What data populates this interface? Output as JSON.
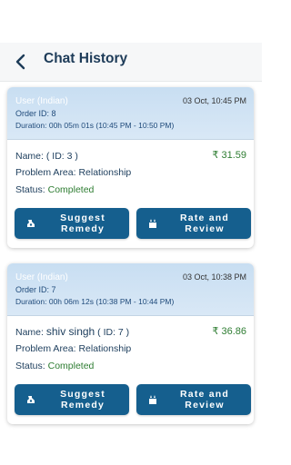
{
  "header": {
    "title": "Chat History"
  },
  "orders": [
    {
      "user": "User (Indian)",
      "date": "03 Oct, 10:45 PM",
      "order_id": "Order ID: 8",
      "duration": "Duration: 00h 05m 01s (10:45 PM - 10:50 PM)",
      "name_label": "Name:",
      "name": "",
      "id_text": "( ID: 3 )",
      "price": "₹ 31.59",
      "problem": "Problem Area: Relationship",
      "status_label": "Status:",
      "status_value": "Completed",
      "suggest_line1": "Suggest",
      "suggest_line2": "Remedy",
      "rate_line1": "Rate and",
      "rate_line2": "Review"
    },
    {
      "user": "User (Indian)",
      "date": "03 Oct, 10:38 PM",
      "order_id": "Order ID: 7",
      "duration": "Duration: 00h 06m 12s (10:38 PM - 10:44 PM)",
      "name_label": "Name:",
      "name": "shiv singh",
      "id_text": "( ID: 7 )",
      "price": "₹ 36.86",
      "problem": "Problem Area: Relationship",
      "status_label": "Status:",
      "status_value": "Completed",
      "suggest_line1": "Suggest",
      "suggest_line2": "Remedy",
      "rate_line1": "Rate and",
      "rate_line2": "Review"
    }
  ],
  "colors": {
    "header_title": "#1d3b58",
    "button_bg": "#155f8e",
    "price": "#2e7d32",
    "status_completed": "#2e7d32",
    "card_top_bg": "#cde1f3"
  },
  "icons": {
    "back": "back-arrow-icon",
    "suggest": "remedy-icon",
    "rate": "review-icon"
  }
}
